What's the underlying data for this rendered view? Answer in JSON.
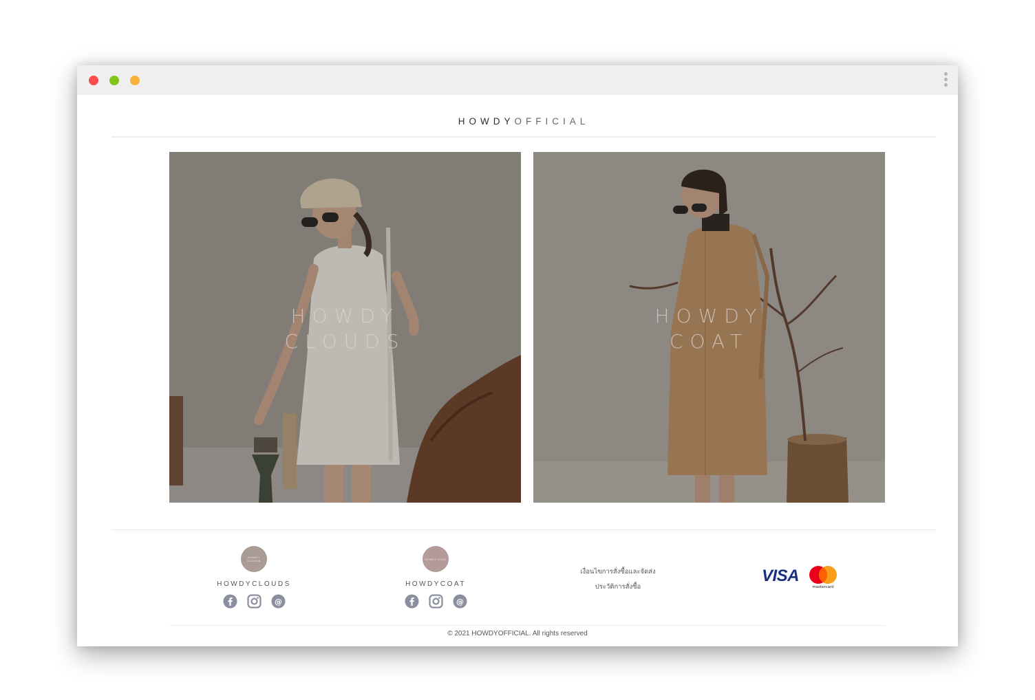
{
  "browser": {
    "controls": [
      "close",
      "minimize",
      "maximize"
    ],
    "menu_icon": "kebab-menu-icon"
  },
  "header": {
    "brand_part1": "HOWDY",
    "brand_part2": "OFFICIAL"
  },
  "collections": [
    {
      "line1": "HOWDY",
      "line2": "CLOUDS"
    },
    {
      "line1": "HOWDY",
      "line2": "COAT"
    }
  ],
  "footer": {
    "brands": [
      {
        "name": "HOWDYCLOUDS",
        "logo_text": "HOWDY CLOUDS",
        "logo_color": "#a99c94"
      },
      {
        "name": "HOWDYCOAT",
        "logo_text": "HOWDY COAT",
        "logo_color": "#b59a9a"
      }
    ],
    "social_icons": [
      "facebook-icon",
      "instagram-icon",
      "line-at-icon"
    ],
    "links": [
      "เงื่อนไขการสั่งซื้อและจัดส่ง",
      "ประวัติการสั่งซื้อ"
    ],
    "payments": {
      "visa": "VISA",
      "mastercard": "mastercard"
    },
    "copyright": "© 2021 HOWDYOFFICIAL. All rights reserved"
  },
  "colors": {
    "accent_text": "#555555",
    "social_icon": "#8a8e9e",
    "visa_blue": "#1a2f7f",
    "mc_red": "#eb001b",
    "mc_orange": "#f79e1b"
  }
}
